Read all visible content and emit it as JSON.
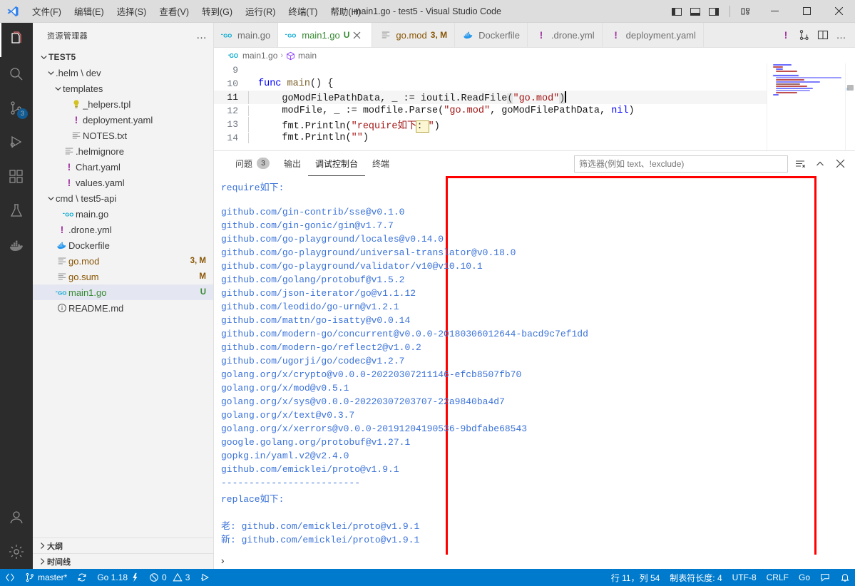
{
  "titlebar": {
    "title": "main1.go - test5 - Visual Studio Code",
    "menu": [
      "文件(F)",
      "编辑(E)",
      "选择(S)",
      "查看(V)",
      "转到(G)",
      "运行(R)",
      "终端(T)",
      "帮助(H)"
    ],
    "layout_buttons": [
      "toggle-primary-sidebar",
      "toggle-panel",
      "toggle-secondary-sidebar",
      "customize-layout"
    ],
    "window_buttons": [
      "minimize",
      "maximize",
      "close"
    ]
  },
  "activitybar": {
    "items": [
      {
        "name": "explorer",
        "icon": "files-icon",
        "active": true,
        "badge": ""
      },
      {
        "name": "search",
        "icon": "search-icon",
        "active": false,
        "badge": ""
      },
      {
        "name": "source-control",
        "icon": "source-control-icon",
        "active": false,
        "badge": "3"
      },
      {
        "name": "run-and-debug",
        "icon": "run-debug-icon",
        "active": false,
        "badge": ""
      },
      {
        "name": "extensions",
        "icon": "extensions-icon",
        "active": false,
        "badge": ""
      },
      {
        "name": "testing",
        "icon": "beaker-icon",
        "active": false,
        "badge": ""
      },
      {
        "name": "docker",
        "icon": "docker-whale-icon",
        "active": false,
        "badge": ""
      }
    ],
    "bottom_items": [
      {
        "name": "accounts",
        "icon": "account-icon"
      },
      {
        "name": "manage",
        "icon": "gear-icon"
      }
    ]
  },
  "sidebar": {
    "title": "资源管理器",
    "more_label": "…",
    "tree": [
      {
        "label": "TEST5",
        "indent": 0,
        "chevron": "down",
        "icon": "",
        "badge": "",
        "root": true,
        "selected": false
      },
      {
        "label": ".helm \\ dev",
        "indent": 1,
        "chevron": "down",
        "icon": "",
        "badge": "",
        "root": false,
        "selected": false
      },
      {
        "label": "templates",
        "indent": 2,
        "chevron": "down",
        "icon": "",
        "badge": "",
        "root": false,
        "selected": false
      },
      {
        "label": "_helpers.tpl",
        "indent": 3,
        "chevron": "none",
        "icon": "bulb-icon",
        "badge": "",
        "root": false,
        "selected": false
      },
      {
        "label": "deployment.yaml",
        "indent": 3,
        "chevron": "none",
        "icon": "yaml-icon",
        "badge": "",
        "root": false,
        "selected": false
      },
      {
        "label": "NOTES.txt",
        "indent": 3,
        "chevron": "none",
        "icon": "text-icon",
        "badge": "",
        "root": false,
        "selected": false
      },
      {
        "label": ".helmignore",
        "indent": 2,
        "chevron": "none",
        "icon": "text-icon",
        "badge": "",
        "root": false,
        "selected": false
      },
      {
        "label": "Chart.yaml",
        "indent": 2,
        "chevron": "none",
        "icon": "yaml-icon",
        "badge": "",
        "root": false,
        "selected": false
      },
      {
        "label": "values.yaml",
        "indent": 2,
        "chevron": "none",
        "icon": "yaml-icon",
        "badge": "",
        "root": false,
        "selected": false
      },
      {
        "label": "cmd \\ test5-api",
        "indent": 1,
        "chevron": "down",
        "icon": "",
        "badge": "",
        "root": false,
        "selected": false
      },
      {
        "label": "main.go",
        "indent": 2,
        "chevron": "none",
        "icon": "go-icon",
        "badge": "",
        "root": false,
        "selected": false
      },
      {
        "label": ".drone.yml",
        "indent": 1,
        "chevron": "none",
        "icon": "yaml-icon",
        "badge": "",
        "root": false,
        "selected": false
      },
      {
        "label": "Dockerfile",
        "indent": 1,
        "chevron": "none",
        "icon": "docker-icon",
        "badge": "",
        "root": false,
        "selected": false
      },
      {
        "label": "go.mod",
        "indent": 1,
        "chevron": "none",
        "icon": "text-icon",
        "badge": "3, M",
        "badge_kind": "M",
        "root": false,
        "selected": false
      },
      {
        "label": "go.sum",
        "indent": 1,
        "chevron": "none",
        "icon": "text-icon",
        "badge": "M",
        "badge_kind": "M",
        "root": false,
        "selected": false
      },
      {
        "label": "main1.go",
        "indent": 1,
        "chevron": "none",
        "icon": "go-icon",
        "badge": "U",
        "badge_kind": "U",
        "root": false,
        "selected": true
      },
      {
        "label": "README.md",
        "indent": 1,
        "chevron": "none",
        "icon": "info-icon",
        "badge": "",
        "root": false,
        "selected": false
      }
    ],
    "sections": [
      {
        "label": "大纲",
        "expanded": false
      },
      {
        "label": "时间线",
        "expanded": false
      }
    ]
  },
  "tabs": [
    {
      "label": "main.go",
      "icon": "go-icon",
      "badge": "",
      "active": false,
      "close": false
    },
    {
      "label": "main1.go",
      "icon": "go-icon",
      "badge": "U",
      "badge_kind": "U",
      "active": true,
      "close": true
    },
    {
      "label": "go.mod",
      "icon": "text-icon",
      "badge": "3, M",
      "badge_kind": "M",
      "active": false,
      "close": false
    },
    {
      "label": "Dockerfile",
      "icon": "docker-icon",
      "badge": "",
      "active": false,
      "close": false
    },
    {
      "label": ".drone.yml",
      "icon": "yaml-icon",
      "badge": "",
      "active": false,
      "close": false
    },
    {
      "label": "deployment.yaml",
      "icon": "yaml-icon",
      "badge": "",
      "active": false,
      "close": false
    }
  ],
  "tabbar_actions": {
    "warning_icon": "warning-exclamation-icon",
    "split_run_icon": "run-split-icon",
    "split_editor_icon": "split-editor-icon",
    "more_icon": "more-actions-icon"
  },
  "breadcrumb": {
    "file": "main1.go",
    "file_icon": "go-icon",
    "separator": "›",
    "symbol": "main",
    "symbol_icon": "symbol-package-icon"
  },
  "editor": {
    "lines": [
      {
        "n": "9",
        "segments": []
      },
      {
        "n": "10",
        "segments": [
          {
            "t": "func ",
            "c": "kw"
          },
          {
            "t": "main",
            "c": "fn"
          },
          {
            "t": "() {",
            "c": "plain"
          }
        ]
      },
      {
        "n": "11",
        "current": true,
        "indent": true,
        "segments": [
          {
            "t": "    goModFilePathData, _ := ioutil.ReadFile",
            "c": "plain"
          },
          {
            "t": "(",
            "c": "brkt"
          },
          {
            "t": "\"go.mod\"",
            "c": "str"
          },
          {
            "t": ")",
            "c": "brkt"
          }
        ],
        "caret": true
      },
      {
        "n": "12",
        "indent": true,
        "segments": [
          {
            "t": "    modFile, _ := modfile.Parse(",
            "c": "plain"
          },
          {
            "t": "\"go.mod\"",
            "c": "str"
          },
          {
            "t": ", goModFilePathData, ",
            "c": "plain"
          },
          {
            "t": "nil",
            "c": "nil"
          },
          {
            "t": ")",
            "c": "plain"
          }
        ]
      },
      {
        "n": "13",
        "indent": true,
        "segments": [
          {
            "t": "    fmt.Println(",
            "c": "plain"
          },
          {
            "t": "\"require如下",
            "c": "str"
          },
          {
            "t": ": ",
            "c": "sel"
          },
          {
            "t": "\"",
            "c": "str"
          },
          {
            "t": ")",
            "c": "plain"
          }
        ]
      },
      {
        "n": "14",
        "indent": true,
        "segments": [
          {
            "t": "    fmt.Println(",
            "c": "plain"
          },
          {
            "t": "\"\"",
            "c": "str"
          },
          {
            "t": ")",
            "c": "plain"
          }
        ]
      }
    ]
  },
  "panel": {
    "tabs": [
      {
        "label": "问题",
        "count": "3",
        "active": false
      },
      {
        "label": "输出",
        "count": "",
        "active": false
      },
      {
        "label": "调试控制台",
        "count": "",
        "active": true
      },
      {
        "label": "终端",
        "count": "",
        "active": false
      }
    ],
    "filter_placeholder": "筛选器(例如 text、!exclude)",
    "actions": [
      {
        "name": "clear-console",
        "icon": "clear-console-icon"
      },
      {
        "name": "collapse-panel",
        "icon": "chevron-up-icon"
      },
      {
        "name": "close-panel",
        "icon": "close-icon"
      }
    ],
    "prompt": "›",
    "console_output": [
      "require如下:",
      "",
      "github.com/gin-contrib/sse@v0.1.0",
      "github.com/gin-gonic/gin@v1.7.7",
      "github.com/go-playground/locales@v0.14.0",
      "github.com/go-playground/universal-translator@v0.18.0",
      "github.com/go-playground/validator/v10@v10.10.1",
      "github.com/golang/protobuf@v1.5.2",
      "github.com/json-iterator/go@v1.1.12",
      "github.com/leodido/go-urn@v1.2.1",
      "github.com/mattn/go-isatty@v0.0.14",
      "github.com/modern-go/concurrent@v0.0.0-20180306012644-bacd9c7ef1dd",
      "github.com/modern-go/reflect2@v1.0.2",
      "github.com/ugorji/go/codec@v1.2.7",
      "golang.org/x/crypto@v0.0.0-20220307211146-efcb8507fb70",
      "golang.org/x/mod@v0.5.1",
      "golang.org/x/sys@v0.0.0-20220307203707-22a9840ba4d7",
      "golang.org/x/text@v0.3.7",
      "golang.org/x/xerrors@v0.0.0-20191204190536-9bdfabe68543",
      "google.golang.org/protobuf@v1.27.1",
      "gopkg.in/yaml.v2@v2.4.0",
      "github.com/emicklei/proto@v1.9.1",
      "-------------------------",
      "replace如下:",
      "",
      "老: github.com/emicklei/proto@v1.9.1",
      "新: github.com/emicklei/proto@v1.9.1"
    ]
  },
  "statusbar": {
    "left": [
      {
        "name": "remote",
        "icon": "remote-icon",
        "label": ""
      },
      {
        "name": "branch",
        "icon": "branch-icon",
        "label": "master*"
      },
      {
        "name": "sync",
        "icon": "sync-icon",
        "label": ""
      },
      {
        "name": "go-version",
        "icon": "",
        "label": "Go 1.18"
      },
      {
        "name": "go-flash",
        "icon": "flash-icon",
        "label": ""
      },
      {
        "name": "problems",
        "icon": "error-warning-icon",
        "label": "0"
      },
      {
        "name": "warnings",
        "icon": "",
        "label": "3"
      },
      {
        "name": "launch",
        "icon": "launch-icon",
        "label": ""
      }
    ],
    "right": [
      {
        "name": "cursor-position",
        "label": "行 11，列 54"
      },
      {
        "name": "indentation",
        "label": "制表符长度: 4"
      },
      {
        "name": "encoding",
        "label": "UTF-8"
      },
      {
        "name": "eol",
        "label": "CRLF"
      },
      {
        "name": "language-mode",
        "label": "Go"
      },
      {
        "name": "feedback",
        "icon": "feedback-icon",
        "label": ""
      },
      {
        "name": "notifications",
        "icon": "bell-icon",
        "label": ""
      }
    ]
  },
  "colors": {
    "accent": "#007acc",
    "annotation_red": "#ff0000",
    "console_blue": "#3a72d9",
    "badge_modified": "#895503",
    "badge_untracked": "#388a34"
  }
}
